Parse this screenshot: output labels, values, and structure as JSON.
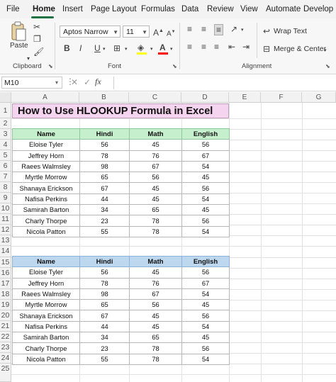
{
  "menu": {
    "items": [
      "File",
      "Home",
      "Insert",
      "Page Layout",
      "Formulas",
      "Data",
      "Review",
      "View",
      "Automate",
      "Develop"
    ],
    "active": "Home"
  },
  "ribbon": {
    "clipboard": {
      "paste_label": "Paste",
      "group_label": "Clipboard"
    },
    "font": {
      "font_name": "Aptos Narrow",
      "font_size": "11",
      "bold": "B",
      "italic": "I",
      "underline": "U",
      "grow": "A",
      "shrink": "A",
      "fill_color": "#ffff00",
      "font_color": "#ff0000",
      "group_label": "Font"
    },
    "alignment": {
      "wrap_text": "Wrap Text",
      "merge_center": "Merge & Center",
      "group_label": "Alignment"
    }
  },
  "formula_bar": {
    "name_box": "M10",
    "fx": "fx",
    "formula": ""
  },
  "sheet": {
    "columns": [
      "A",
      "B",
      "C",
      "D",
      "E",
      "F",
      "G"
    ],
    "rows": [
      "1",
      "2",
      "3",
      "4",
      "5",
      "6",
      "7",
      "8",
      "9",
      "10",
      "11",
      "12",
      "13",
      "14",
      "15",
      "16",
      "17",
      "18",
      "19",
      "20",
      "21",
      "22",
      "23",
      "24",
      "25"
    ],
    "title": "How to Use HLOOKUP Formula in Excel",
    "table1": {
      "headers": [
        "Name",
        "Hindi",
        "Math",
        "English"
      ],
      "rows": [
        [
          "Eloise Tyler",
          "56",
          "45",
          "56"
        ],
        [
          "Jeffrey Horn",
          "78",
          "76",
          "67"
        ],
        [
          "Raees Walmsley",
          "98",
          "67",
          "54"
        ],
        [
          "Myrtle Morrow",
          "65",
          "56",
          "45"
        ],
        [
          "Shanaya Erickson",
          "67",
          "45",
          "56"
        ],
        [
          "Nafisa Perkins",
          "44",
          "45",
          "54"
        ],
        [
          "Samirah Barton",
          "34",
          "65",
          "45"
        ],
        [
          "Charly Thorpe",
          "23",
          "78",
          "56"
        ],
        [
          "Nicola Patton",
          "55",
          "78",
          "54"
        ]
      ]
    },
    "table2": {
      "headers": [
        "Name",
        "Hindi",
        "Math",
        "English"
      ],
      "rows": [
        [
          "Eloise Tyler",
          "56",
          "45",
          "56"
        ],
        [
          "Jeffrey Horn",
          "78",
          "76",
          "67"
        ],
        [
          "Raees Walmsley",
          "98",
          "67",
          "54"
        ],
        [
          "Myrtle Morrow",
          "65",
          "56",
          "45"
        ],
        [
          "Shanaya Erickson",
          "67",
          "45",
          "56"
        ],
        [
          "Nafisa Perkins",
          "44",
          "45",
          "54"
        ],
        [
          "Samirah Barton",
          "34",
          "65",
          "45"
        ],
        [
          "Charly Thorpe",
          "23",
          "78",
          "56"
        ],
        [
          "Nicola Patton",
          "55",
          "78",
          "54"
        ]
      ]
    }
  },
  "colors": {
    "accent": "#217346",
    "table1_header": "#c6efce",
    "table2_header": "#bdd7ee",
    "title_fill": "#f4d4ee"
  }
}
